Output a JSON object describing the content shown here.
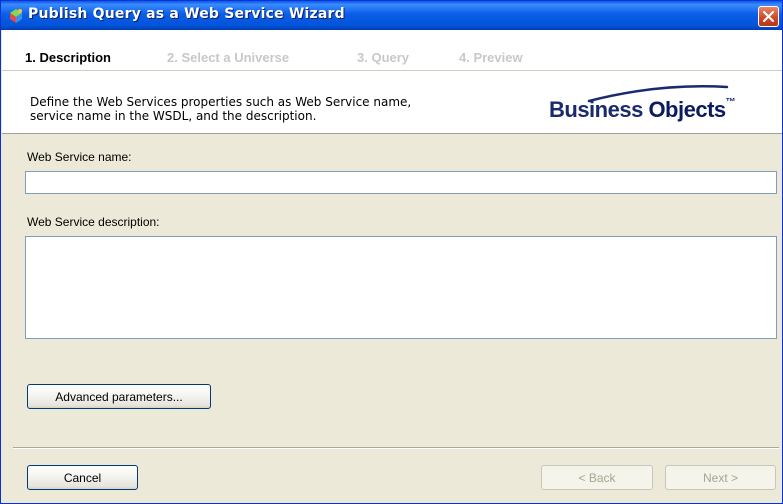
{
  "window": {
    "title": "Publish Query as a Web Service Wizard"
  },
  "steps": [
    {
      "label": "1. Description",
      "active": true
    },
    {
      "label": "2. Select a Universe",
      "active": false
    },
    {
      "label": "3. Query",
      "active": false
    },
    {
      "label": "4. Preview",
      "active": false
    }
  ],
  "header": {
    "description_line1": "Define the Web Services properties such as Web Service name,",
    "description_line2": "service name in the WSDL, and the description.",
    "logo_text_part1": "Business ",
    "logo_text_part2": "Objects",
    "logo_mark": "™"
  },
  "form": {
    "name_label": "Web Service name:",
    "name_value": "",
    "description_label": "Web Service description:",
    "description_value": "",
    "advanced_button": "Advanced parameters..."
  },
  "footer": {
    "cancel_button": "Cancel",
    "back_button": "< Back",
    "next_button": "Next >"
  },
  "colors": {
    "titlebar": "#0a5ee8",
    "close_button": "#d24a26",
    "dialog_background": "#ece9d8",
    "logo_blue": "#1a2a6e"
  }
}
